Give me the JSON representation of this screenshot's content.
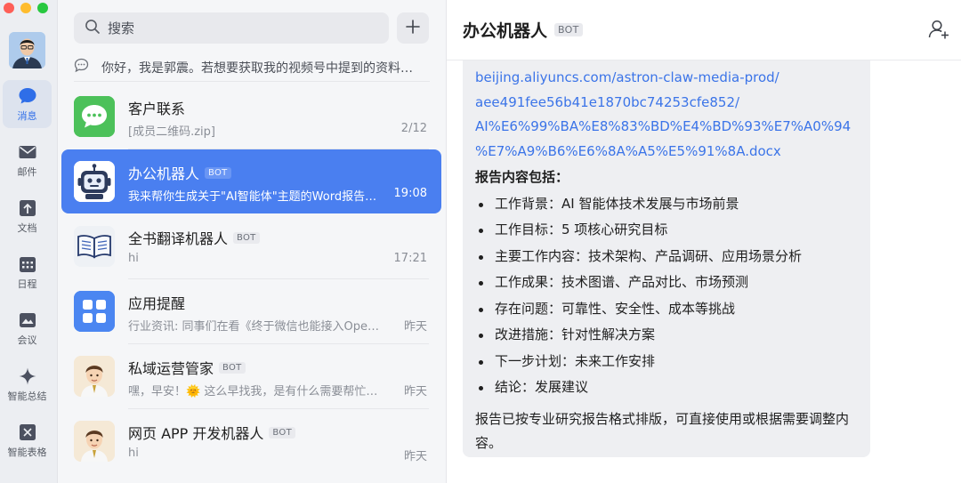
{
  "rail": {
    "items": [
      {
        "label": "消息",
        "icon": "chat-bubble-icon",
        "active": true
      },
      {
        "label": "邮件",
        "icon": "mail-icon"
      },
      {
        "label": "文档",
        "icon": "document-icon"
      },
      {
        "label": "日程",
        "icon": "calendar-icon"
      },
      {
        "label": "会议",
        "icon": "meeting-icon"
      },
      {
        "label": "智能总结",
        "icon": "sparkle-icon"
      },
      {
        "label": "智能表格",
        "icon": "smart-table-icon"
      }
    ]
  },
  "list": {
    "search_placeholder": "搜索",
    "notice": "你好，我是郭震。若想要获取我的视频号中提到的资料，请先关注我的视频号",
    "conversations": [
      {
        "title": "客户联系",
        "bot": false,
        "subtitle": "[成员二维码.zip]",
        "time": "2/12",
        "avatar": "wechat-avatar-icon"
      },
      {
        "title": "办公机器人",
        "bot": true,
        "subtitle": "我来帮你生成关于\"AI智能体\"主题的Word报告文档",
        "time": "19:08",
        "avatar": "robot-avatar-icon",
        "active": true
      },
      {
        "title": "全书翻译机器人",
        "bot": true,
        "subtitle": "hi",
        "time": "17:21",
        "avatar": "book-avatar-icon"
      },
      {
        "title": "应用提醒",
        "bot": false,
        "subtitle": "行业资讯: 同事们在看《终于微信也能接入OpenClaw了》",
        "time": "昨天",
        "avatar": "app-grid-avatar-icon"
      },
      {
        "title": "私域运营管家",
        "bot": true,
        "subtitle": "嘿，早安！🌞 这么早找我，是有什么需要帮忙的吗？",
        "time": "昨天",
        "avatar": "cartoon-man-avatar-icon"
      },
      {
        "title": "网页 APP 开发机器人",
        "bot": true,
        "subtitle": "hi",
        "time": "昨天",
        "avatar": "cartoon-man-avatar-icon"
      }
    ],
    "bot_tag": "BOT"
  },
  "chat": {
    "title": "办公机器人",
    "bot_tag": "BOT",
    "message": {
      "link_lines": [
        "beijing.aliyuncs.com/astron-claw-media-prod/",
        "aee491fee56b41e1870bc74253cfe852/",
        "AI%E6%99%BA%E8%83%BD%E4%BD%93%E7%A0%94",
        "%E7%A9%B6%E6%8A%A5%E5%91%8A.docx"
      ],
      "heading": "报告内容包括：",
      "items": [
        "工作背景：AI 智能体技术发展与市场前景",
        "工作目标：5 项核心研究目标",
        "主要工作内容：技术架构、产品调研、应用场景分析",
        "工作成果：技术图谱、产品对比、市场预测",
        "存在问题：可靠性、安全性、成本等挑战",
        "改进措施：针对性解决方案",
        "下一步计划：未来工作安排",
        "结论：发展建议"
      ],
      "summary": "报告已按专业研究报告格式排版，可直接使用或根据需要调整内容。"
    }
  },
  "colors": {
    "accent": "#4a7ff0",
    "link": "#3b74e8",
    "rail_bg": "#eceef2",
    "list_bg": "#f5f6f8",
    "bubble_bg": "#eeeff2"
  }
}
